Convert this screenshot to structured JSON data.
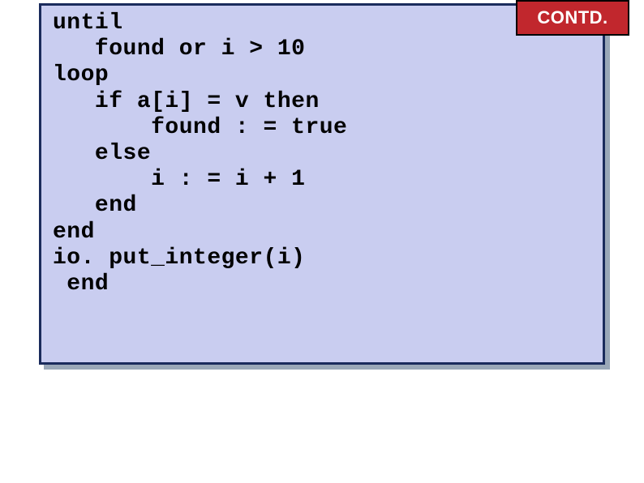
{
  "badge": {
    "label": "CONTD."
  },
  "code": {
    "lines": [
      "until",
      "   found or i > 10",
      "loop",
      "   if a[i] = v then",
      "       found : = true",
      "   else",
      "       i : = i + 1",
      "   end",
      "end",
      "io. put_integer(i)",
      " end"
    ]
  }
}
